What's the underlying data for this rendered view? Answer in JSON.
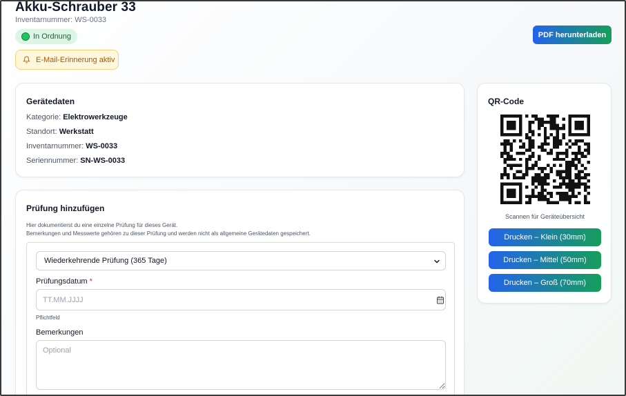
{
  "header": {
    "title": "Akku-Schrauber 33",
    "subtitle": "Inventarnummer: WS-0033",
    "status": "In Ordnung",
    "reminder": "E-Mail-Erinnerung aktiv",
    "pdf_button": "PDF herunterladen"
  },
  "details": {
    "title": "Gerätedaten",
    "rows": [
      {
        "label": "Kategorie:",
        "value": "Elektrowerkzeuge"
      },
      {
        "label": "Standort:",
        "value": "Werkstatt"
      },
      {
        "label": "Inventarnummer:",
        "value": "WS-0033"
      },
      {
        "label": "Seriennummer:",
        "value": "SN-WS-0033"
      }
    ]
  },
  "qr": {
    "title": "QR-Code",
    "caption": "Scannen für Geräteübersicht",
    "buttons": [
      "Drucken – Klein (30mm)",
      "Drucken – Mittel (50mm)",
      "Drucken – Groß (70mm)"
    ]
  },
  "inspection": {
    "title": "Prüfung hinzufügen",
    "desc_line1": "Hier dokumentierst du eine einzelne Prüfung für dieses Gerät.",
    "desc_line2": "Bemerkungen und Messwerte gehören zu dieser Prüfung und werden nicht als allgemeine Gerätedaten gespeichert.",
    "type_selected": "Wiederkehrende Prüfung (365 Tage)",
    "date_label": "Prüfungsdatum",
    "date_required": "*",
    "date_placeholder": "TT.MM.JJJJ",
    "date_hint": "Pflichtfeld",
    "remarks_label": "Bemerkungen",
    "remarks_placeholder": "Optional"
  },
  "colors": {
    "accent_blue": "#2563eb",
    "accent_green": "#169e5a",
    "status_green": "#22c55e",
    "reminder_amber": "#a15c07"
  }
}
